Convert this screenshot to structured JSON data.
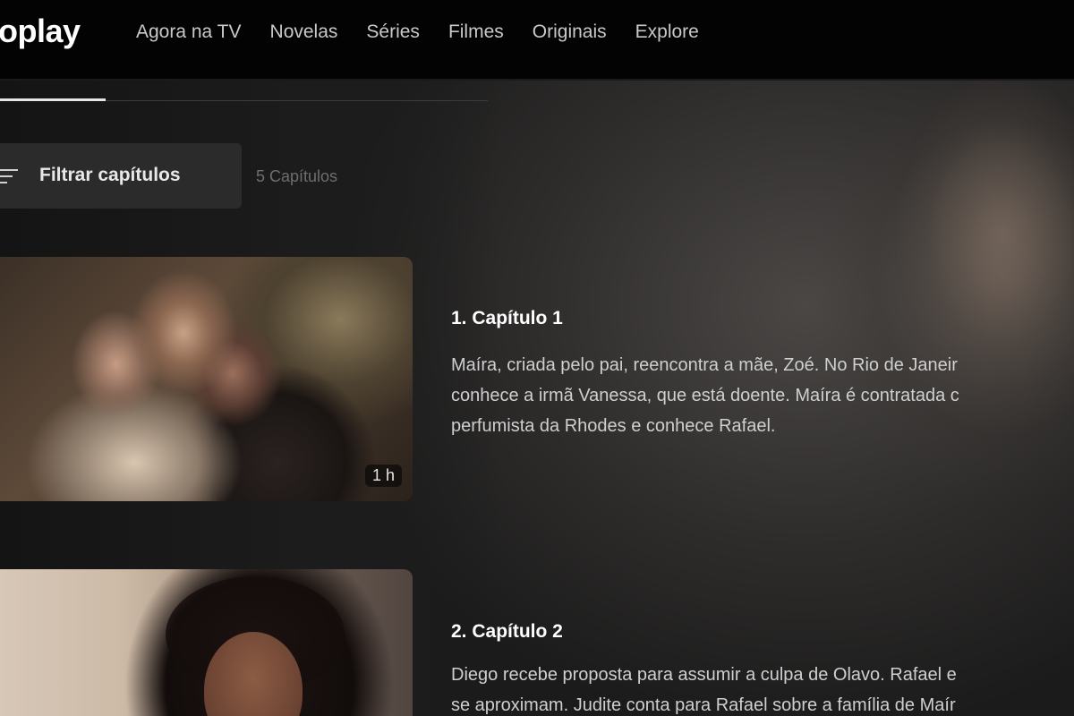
{
  "header": {
    "logo_text": "oplay",
    "nav": [
      {
        "label": "Agora na TV"
      },
      {
        "label": "Novelas"
      },
      {
        "label": "Séries"
      },
      {
        "label": "Filmes"
      },
      {
        "label": "Originais"
      },
      {
        "label": "Explore"
      }
    ]
  },
  "filter": {
    "label": "Filtrar capítulos",
    "icon": "filter-lines-icon",
    "count_text": "5 Capítulos"
  },
  "episodes": [
    {
      "title": "1. Capítulo 1",
      "duration": "1 h",
      "description_lines": [
        "Maíra, criada pelo pai, reencontra a mãe, Zoé. No Rio de Janeir",
        "conhece a irmã Vanessa, que está doente. Maíra é contratada c",
        "perfumista da Rhodes e conhece Rafael."
      ]
    },
    {
      "title": "2. Capítulo 2",
      "description_lines": [
        "Diego recebe proposta para assumir a culpa de Olavo. Rafael e",
        "se aproximam. Judite conta para Rafael sobre a família de Maír"
      ]
    }
  ],
  "colors": {
    "header_bg": "#030303",
    "page_bg": "#1a1a1a",
    "filter_bg": "#2b2b2b",
    "text_primary": "#ffffff",
    "text_secondary": "#cfcfcf",
    "text_muted": "#6e6e6e"
  }
}
